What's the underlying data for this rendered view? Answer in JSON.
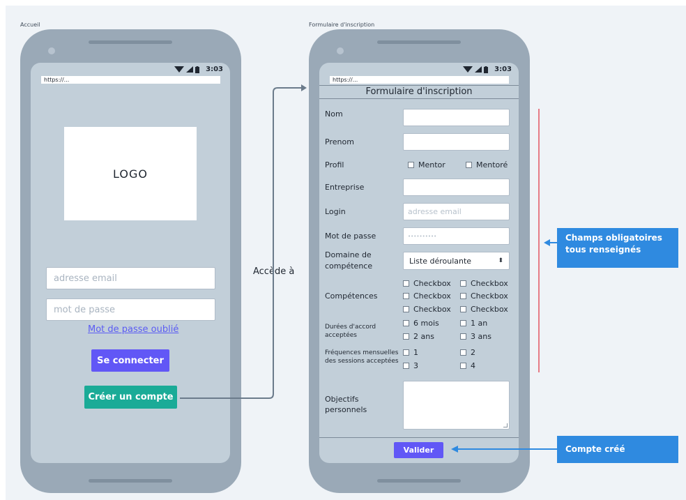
{
  "frames": {
    "left": "Accueil",
    "right": "Formulaire d'inscription"
  },
  "status": {
    "time": "3:03"
  },
  "urlbar": {
    "url": "https://..."
  },
  "home": {
    "logo": "LOGO",
    "email_placeholder": "adresse email",
    "password_placeholder": "mot de passe",
    "forgot_link": "Mot de passe oublié",
    "connect_button": "Se connecter",
    "create_button": "Créer un compte"
  },
  "flow": {
    "label": "Accède à"
  },
  "form": {
    "title": "Formulaire d'inscription",
    "nom": "Nom",
    "prenom": "Prenom",
    "profil": "Profil",
    "profil_options": [
      "Mentor",
      "Mentoré"
    ],
    "entreprise": "Entreprise",
    "login": "Login",
    "login_placeholder": "adresse email",
    "password": "Mot de passe",
    "password_mask": "••••••••••",
    "domaine_line1": "Domaine de",
    "domaine_line2": "compétence",
    "select_value": "Liste déroulante",
    "competences": "Compétences",
    "competences_options": [
      "Checkbox",
      "Checkbox",
      "Checkbox",
      "Checkbox",
      "Checkbox",
      "Checkbox"
    ],
    "durees_line1": "Durées d'accord",
    "durees_line2": "acceptées",
    "durees_options": [
      "6 mois",
      "1 an",
      "2 ans",
      "3 ans"
    ],
    "frequences_line1": "Fréquences mensuelles",
    "frequences_line2": "des sessions acceptées",
    "frequences_options": [
      "1",
      "2",
      "3",
      "4"
    ],
    "objectifs_line1": "Objectifs",
    "objectifs_line2": "personnels",
    "submit_button": "Valider"
  },
  "annotations": {
    "required_line1": "Champs obligatoires",
    "required_line2": "tous renseignés",
    "created": "Compte créé"
  },
  "colors": {
    "primary": "#6157f6",
    "teal": "#1aab97",
    "note": "#2f8ae0",
    "required_line": "#e03b4a"
  }
}
